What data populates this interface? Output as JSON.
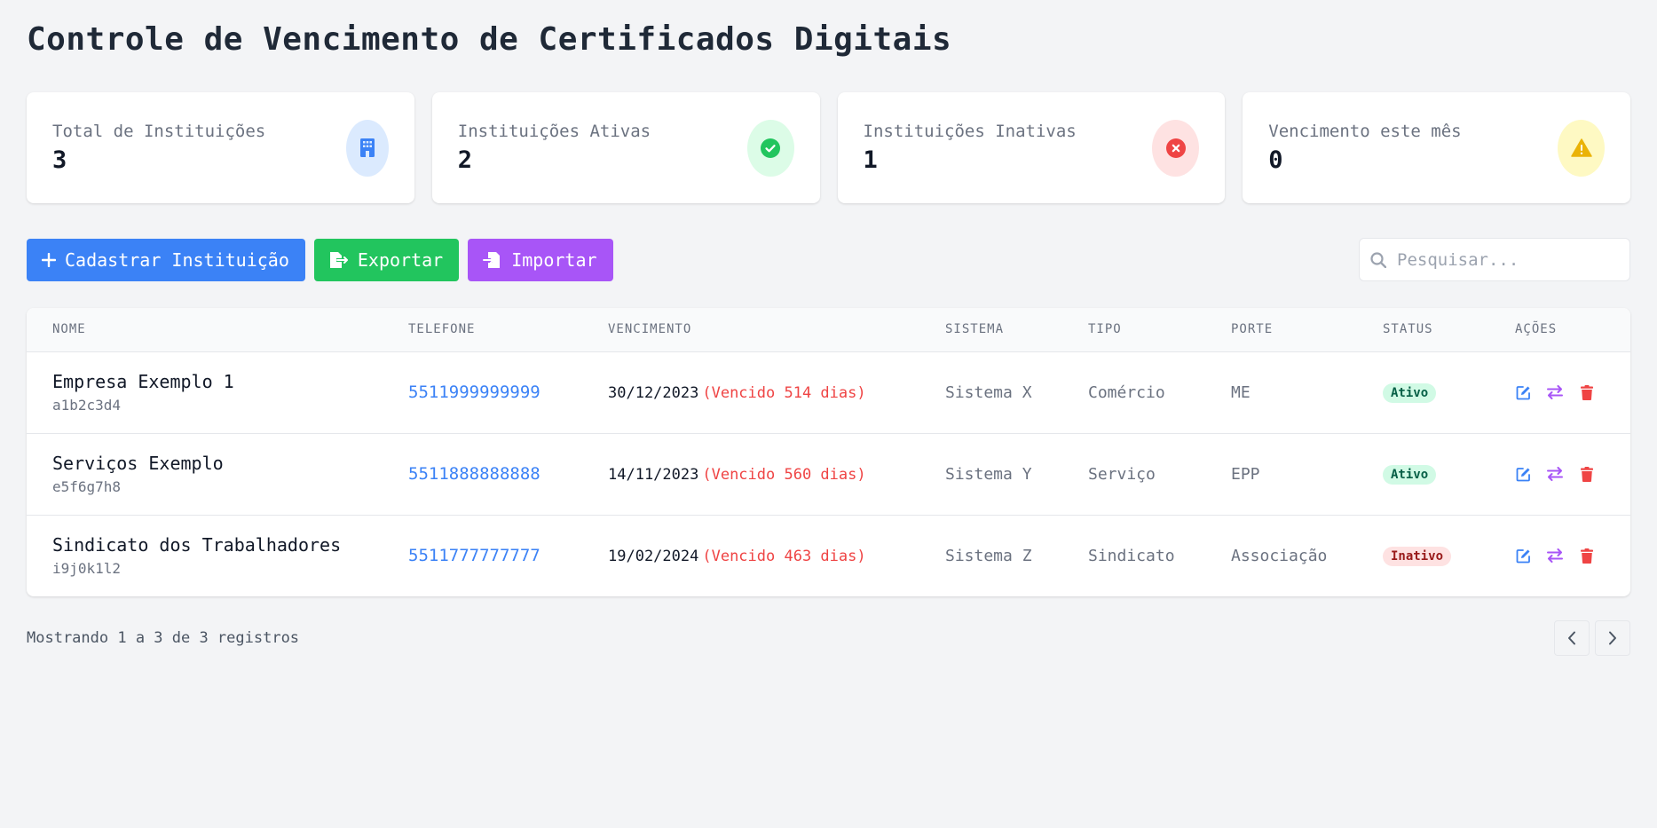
{
  "page": {
    "title": "Controle de Vencimento de Certificados Digitais"
  },
  "stats": [
    {
      "label": "Total de Instituições",
      "value": "3",
      "icon": "building-icon",
      "bg": "#dbeafe",
      "color": "#3b82f6"
    },
    {
      "label": "Instituições Ativas",
      "value": "2",
      "icon": "check-circle-icon",
      "bg": "#dcfce7",
      "color": "#22c55e"
    },
    {
      "label": "Instituições Inativas",
      "value": "1",
      "icon": "x-circle-icon",
      "bg": "#fee2e2",
      "color": "#ef4444"
    },
    {
      "label": "Vencimento este mês",
      "value": "0",
      "icon": "warning-icon",
      "bg": "#fef9c3",
      "color": "#eab308"
    }
  ],
  "toolbar": {
    "add_label": "Cadastrar Instituição",
    "export_label": "Exportar",
    "import_label": "Importar",
    "search_placeholder": "Pesquisar..."
  },
  "table": {
    "headers": [
      "NOME",
      "TELEFONE",
      "VENCIMENTO",
      "SISTEMA",
      "TIPO",
      "PORTE",
      "STATUS",
      "AÇÕES"
    ],
    "rows": [
      {
        "name": "Empresa Exemplo 1",
        "code": "a1b2c3d4",
        "phone": "5511999999999",
        "date": "30/12/2023",
        "overdue": "(Vencido 514 dias)",
        "system": "Sistema X",
        "type": "Comércio",
        "size": "ME",
        "status": "Ativo",
        "status_kind": "ok"
      },
      {
        "name": "Serviços Exemplo",
        "code": "e5f6g7h8",
        "phone": "5511888888888",
        "date": "14/11/2023",
        "overdue": "(Vencido 560 dias)",
        "system": "Sistema Y",
        "type": "Serviço",
        "size": "EPP",
        "status": "Ativo",
        "status_kind": "ok"
      },
      {
        "name": "Sindicato dos Trabalhadores",
        "code": "i9j0k1l2",
        "phone": "5511777777777",
        "date": "19/02/2024",
        "overdue": "(Vencido 463 dias)",
        "system": "Sistema Z",
        "type": "Sindicato",
        "size": "Associação",
        "status": "Inativo",
        "status_kind": "bad"
      }
    ]
  },
  "footer": {
    "info": "Mostrando 1 a 3 de 3 registros"
  },
  "colors": {
    "accent": "#3b82f6",
    "success": "#22c55e",
    "danger": "#ef4444",
    "purple": "#a855f7"
  }
}
